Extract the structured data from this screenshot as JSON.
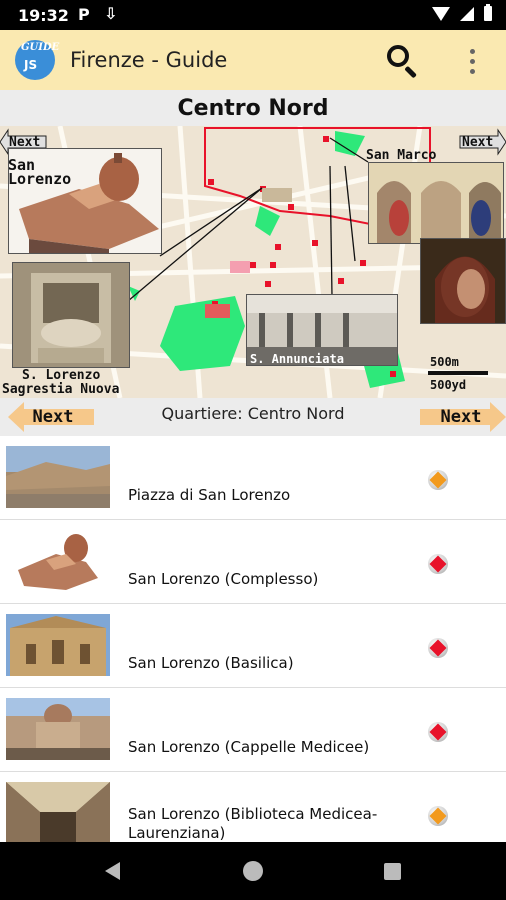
{
  "status": {
    "time": "19:32",
    "icon_p": "P",
    "icon_dl": "⇩"
  },
  "app": {
    "logo_top": "GUIDE",
    "logo_js": "JS",
    "title": "Firenze - Guide"
  },
  "section": {
    "title": "Centro Nord"
  },
  "map": {
    "next_top_left": "Next",
    "next_top_right": "Next",
    "san_lorenzo": "San\nLorenzo",
    "san_marco": "San Marco",
    "sacrestia_1": "S. Lorenzo",
    "sacrestia_2": "Sagrestia Nuova",
    "annunziata": "S. Annunciata",
    "scale_m": "500m",
    "scale_yd": "500yd"
  },
  "nav": {
    "prev_label": "Next",
    "next_label": "Next",
    "district": "Quartiere: Centro Nord"
  },
  "list": [
    {
      "name": "Piazza di San Lorenzo",
      "marker_color": "#f29a1e"
    },
    {
      "name": "San Lorenzo (Complesso)",
      "marker_color": "#e8122a"
    },
    {
      "name": "San Lorenzo (Basilica)",
      "marker_color": "#e8122a"
    },
    {
      "name": "San Lorenzo (Cappelle Medicee)",
      "marker_color": "#e8122a"
    },
    {
      "name": "San Lorenzo (Biblioteca Medicea-Laurenziana)",
      "marker_color": "#f29a1e"
    }
  ],
  "colors": {
    "app_bar": "#fae9b1",
    "map_green": "#2ee87a",
    "map_red": "#e8122a",
    "arrow": "#f6c88a"
  },
  "icons": {
    "search": "search-icon",
    "overflow": "overflow-menu-icon",
    "back": "back-icon",
    "home": "home-icon",
    "recents": "recents-icon"
  }
}
